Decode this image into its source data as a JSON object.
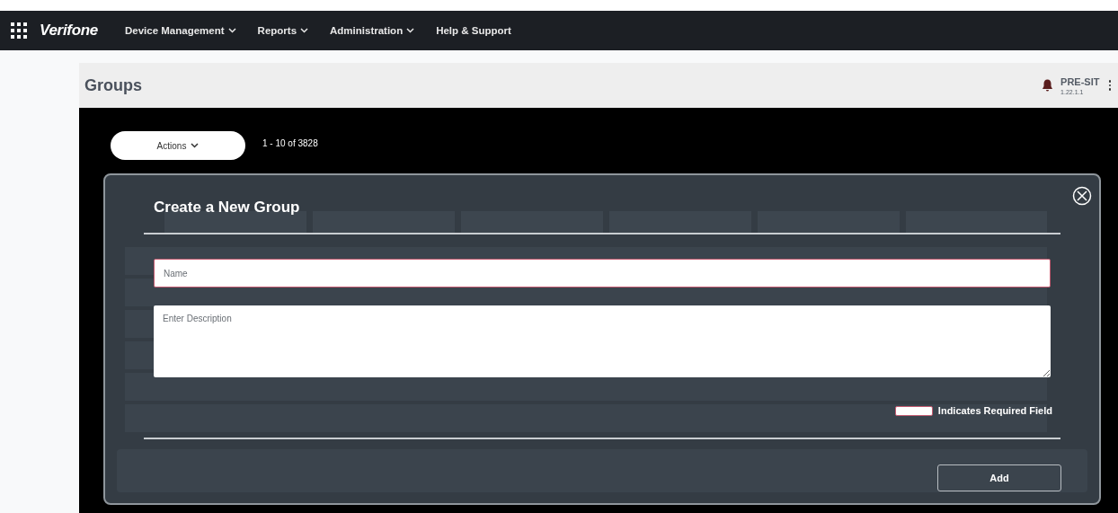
{
  "nav": {
    "logo": "Verifone",
    "items": [
      {
        "label": "Device Management",
        "dropdown": true
      },
      {
        "label": "Reports",
        "dropdown": true
      },
      {
        "label": "Administration",
        "dropdown": true
      },
      {
        "label": "Help & Support",
        "dropdown": false
      }
    ]
  },
  "page": {
    "title": "Groups",
    "environment": "PRE-SIT",
    "version": "1.22.1.1"
  },
  "toolbar": {
    "actions": "Actions",
    "count": "1 - 10 of 3828"
  },
  "dialog": {
    "title": "Create a New Group",
    "name_placeholder": "Name",
    "description_placeholder": "Enter Description",
    "required_legend": "Indicates Required Field",
    "add": "Add"
  }
}
